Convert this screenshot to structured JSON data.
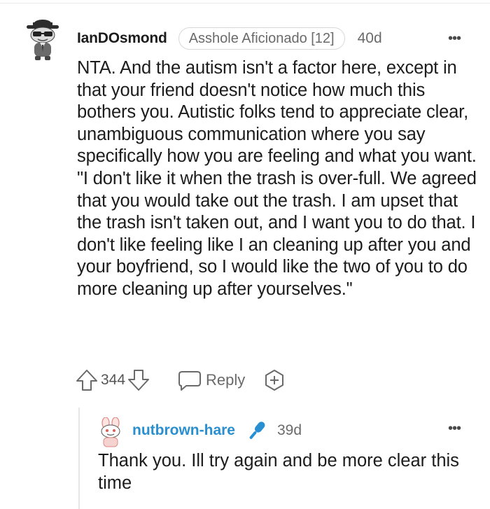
{
  "comment": {
    "username": "IanDOsmond",
    "flair": "Asshole Aficionado [12]",
    "age": "40d",
    "more_label": "•••",
    "body": "NTA. And the autism isn't a factor here, except in that your friend doesn't notice how much this bothers you. Autistic folks tend to appreciate clear, unambiguous communication where you say specifically how you are feeling and what you want. \"I don't like it when the trash is over-full. We agreed that you would take out the trash. I am upset that the trash isn't taken out, and I want you to do that. I don't like feeling like I an cleaning up after you and your boyfriend, so I would like the two of you to do more cleaning up after yourselves.\"",
    "score": "344",
    "reply_label": "Reply",
    "icons": [
      "avatar-snoo-fedora",
      "upvote-arrow-icon",
      "downvote-arrow-icon",
      "chat-bubble-icon",
      "award-plus-icon",
      "more-dots-icon"
    ]
  },
  "reply": {
    "username": "nutbrown-hare",
    "username_color": "#2a8fd0",
    "badge_icon": "microphone-icon (op)",
    "age": "39d",
    "more_label": "•••",
    "body": "Thank you. Ill try again and be more clear this time"
  }
}
